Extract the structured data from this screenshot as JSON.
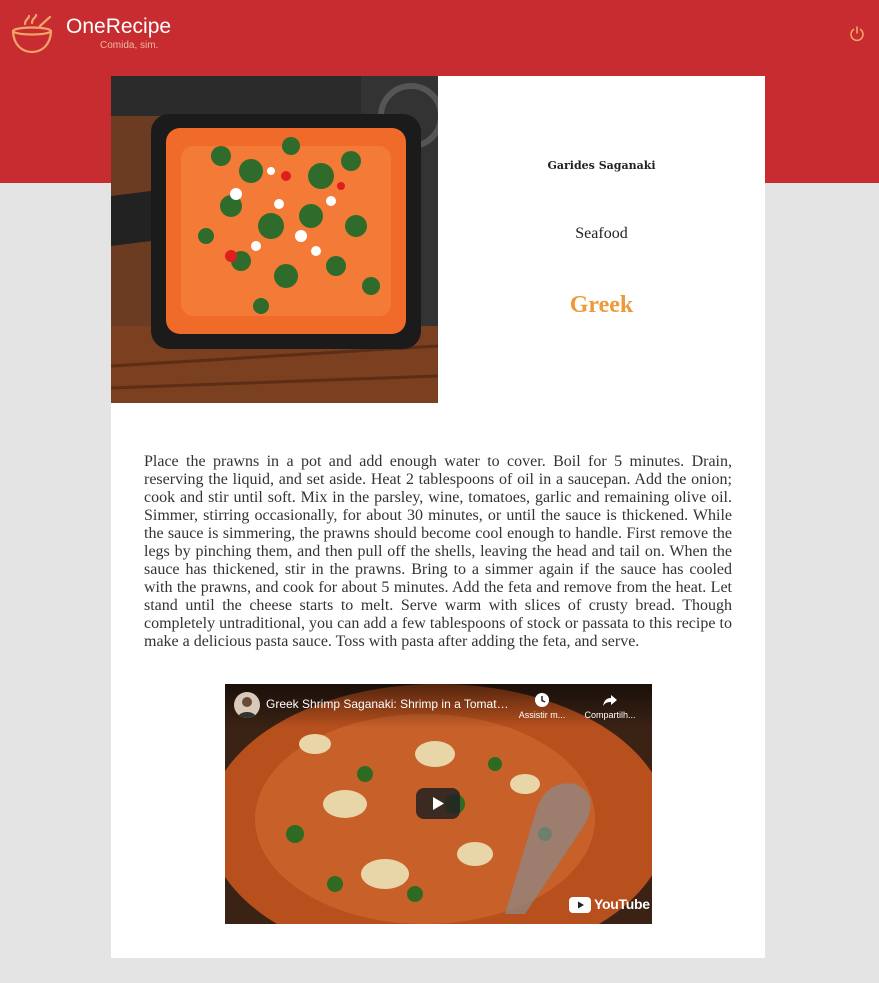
{
  "header": {
    "brand_name": "OneRecipe",
    "tagline": "Comida, sim.",
    "logo_icon": "bowl-icon",
    "logout_icon": "power-icon",
    "background_color": "#c62c30"
  },
  "recipe": {
    "title": "Garides Saganaki",
    "category": "Seafood",
    "area": "Greek",
    "area_color": "#ec9a3a",
    "instructions": "Place the prawns in a pot and add enough water to cover. Boil for 5 minutes. Drain, reserving the liquid, and set aside. Heat 2 tablespoons of oil in a saucepan. Add the onion; cook and stir until soft. Mix in the parsley, wine, tomatoes, garlic and remaining olive oil. Simmer, stirring occasionally, for about 30 minutes, or until the sauce is thickened. While the sauce is simmering, the prawns should become cool enough to handle. First remove the legs by pinching them, and then pull off the shells, leaving the head and tail on. When the sauce has thickened, stir in the prawns. Bring to a simmer again if the sauce has cooled with the prawns, and cook for about 5 minutes. Add the feta and remove from the heat. Let stand until the cheese starts to melt. Serve warm with slices of crusty bread. Though completely untraditional, you can add a few tablespoons of stock or passata to this recipe to make a delicious pasta sauce. Toss with pasta after adding the feta, and serve."
  },
  "video": {
    "title": "Greek Shrimp Saganaki: Shrimp in a Tomato...",
    "watch_later_label": "Assistir m...",
    "share_label": "Compartilh...",
    "play_icon": "play-icon",
    "brand_label": "YouTube"
  }
}
